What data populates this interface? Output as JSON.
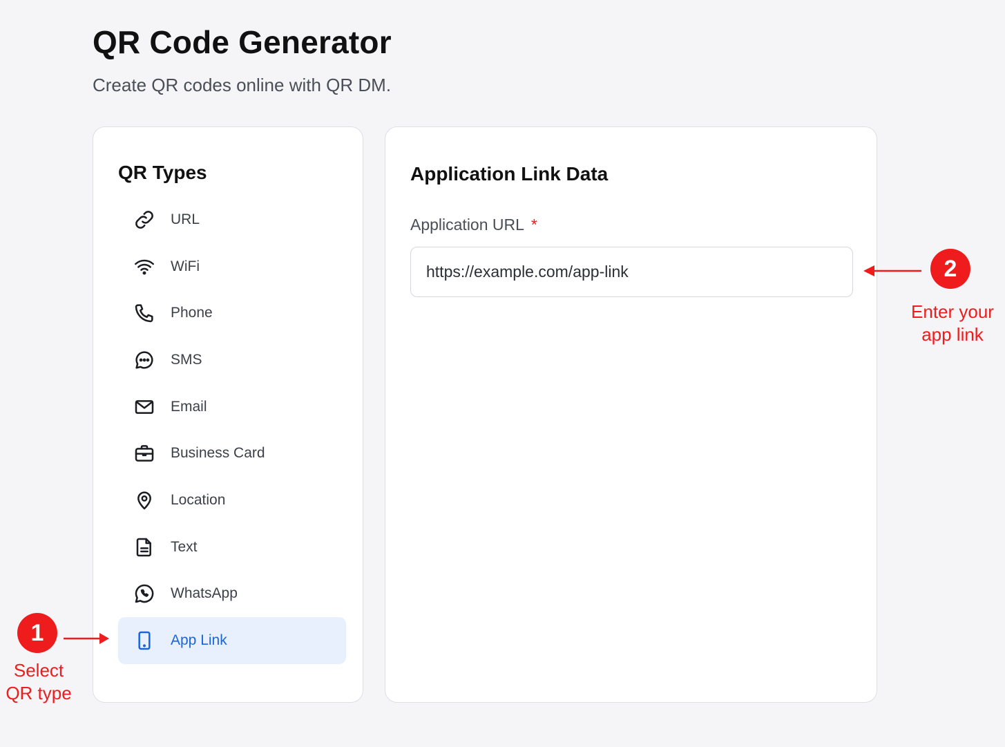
{
  "header": {
    "title": "QR Code Generator",
    "subtitle": "Create QR codes online with QR DM."
  },
  "sidebar": {
    "heading": "QR Types",
    "items": [
      {
        "label": "URL",
        "icon": "link-icon"
      },
      {
        "label": "WiFi",
        "icon": "wifi-icon"
      },
      {
        "label": "Phone",
        "icon": "phone-icon"
      },
      {
        "label": "SMS",
        "icon": "chat-bubble-icon"
      },
      {
        "label": "Email",
        "icon": "envelope-icon"
      },
      {
        "label": "Business Card",
        "icon": "briefcase-icon"
      },
      {
        "label": "Location",
        "icon": "map-pin-icon"
      },
      {
        "label": "Text",
        "icon": "document-icon"
      },
      {
        "label": "WhatsApp",
        "icon": "whatsapp-icon"
      },
      {
        "label": "App Link",
        "icon": "smartphone-icon",
        "selected": true
      }
    ]
  },
  "main": {
    "heading": "Application Link Data",
    "field_label": "Application URL",
    "required_mark": "*",
    "url_value": "https://example.com/app-link"
  },
  "annotations": {
    "step1_number": "1",
    "step1_text_line1": "Select",
    "step1_text_line2": "QR type",
    "step2_number": "2",
    "step2_text_line1": "Enter your",
    "step2_text_line2": "app link"
  },
  "colors": {
    "accent": "#1a66d9",
    "selected_bg": "#e8f0fd",
    "annotation_red": "#ee1c1c",
    "page_bg": "#f5f5f8"
  }
}
